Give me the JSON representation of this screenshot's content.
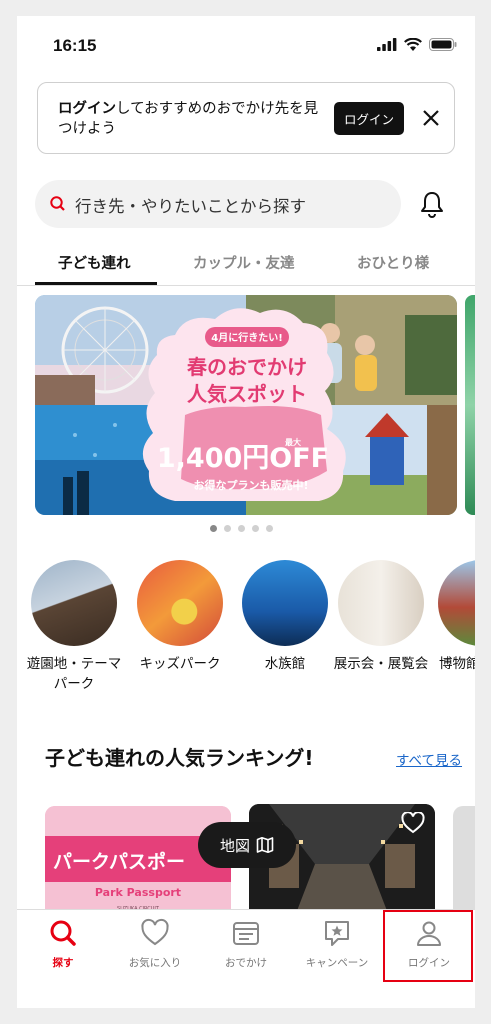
{
  "status_bar": {
    "time": "16:15"
  },
  "login_banner": {
    "bold_text": "ログイン",
    "text": "しておすすめのおでかけ先を見つけよう",
    "button": "ログイン"
  },
  "search": {
    "placeholder": "行き先・やりたいことから探す"
  },
  "tabs": [
    {
      "label": "子ども連れ",
      "active": true
    },
    {
      "label": "カップル・友達",
      "active": false
    },
    {
      "label": "おひとり様",
      "active": false
    }
  ],
  "hero": {
    "badge": "4月に行きたい!",
    "title_line1": "春のおでかけ",
    "title_line2": "人気スポット",
    "discount_prefix": "最大",
    "discount": "1,400円OFF",
    "subtitle": "お得なプランも販売中!",
    "pager": {
      "total": 5,
      "current": 1
    }
  },
  "categories": [
    {
      "label": "遊園地・テーマパーク"
    },
    {
      "label": "キッズパーク"
    },
    {
      "label": "水族館"
    },
    {
      "label": "展示会・展覧会"
    },
    {
      "label": "博物館"
    }
  ],
  "ranking": {
    "title": "子ども連れの人気ランキング!",
    "see_all": "すべて見る",
    "card1_title": "パークパスポー",
    "card1_sub": "Park Passport",
    "card1_brand": "SUZUKA CIRCUIT"
  },
  "map_button": {
    "label": "地図"
  },
  "bottom_nav": [
    {
      "label": "探す",
      "icon": "search-icon",
      "active": true
    },
    {
      "label": "お気に入り",
      "icon": "heart-icon",
      "active": false
    },
    {
      "label": "おでかけ",
      "icon": "ticket-icon",
      "active": false
    },
    {
      "label": "キャンペーン",
      "icon": "campaign-icon",
      "active": false
    },
    {
      "label": "ログイン",
      "icon": "person-icon",
      "active": false
    }
  ],
  "colors": {
    "accent": "#e60012",
    "link": "#1a66c9"
  }
}
